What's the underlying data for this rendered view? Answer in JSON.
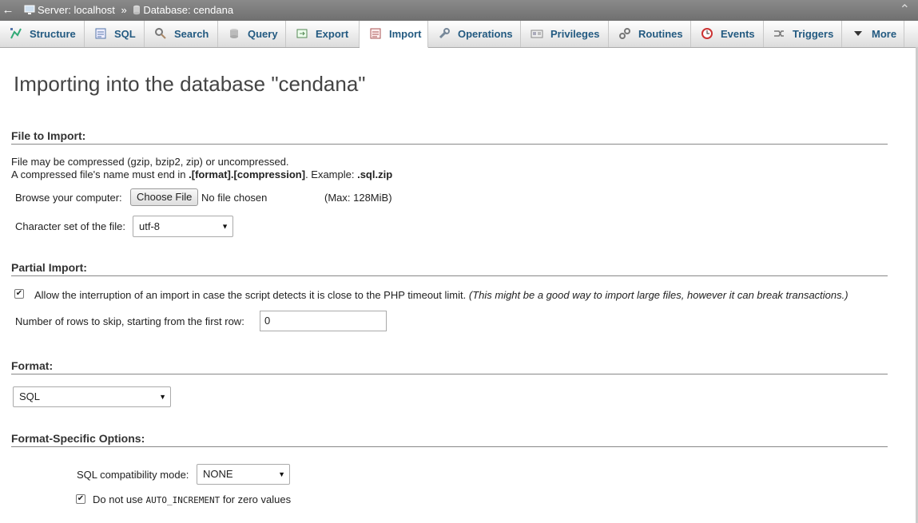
{
  "breadcrumb": {
    "server": "Server: localhost",
    "separator": "»",
    "database": "Database: cendana"
  },
  "tabs": [
    {
      "label": "Structure",
      "icon": "structure-icon"
    },
    {
      "label": "SQL",
      "icon": "sql-icon"
    },
    {
      "label": "Search",
      "icon": "search-icon"
    },
    {
      "label": "Query",
      "icon": "query-icon"
    },
    {
      "label": "Export",
      "icon": "export-icon"
    },
    {
      "label": "Import",
      "icon": "import-icon",
      "active": true
    },
    {
      "label": "Operations",
      "icon": "wrench-icon"
    },
    {
      "label": "Privileges",
      "icon": "privileges-icon"
    },
    {
      "label": "Routines",
      "icon": "routines-icon"
    },
    {
      "label": "Events",
      "icon": "clock-icon"
    },
    {
      "label": "Triggers",
      "icon": "triggers-icon"
    },
    {
      "label": "More",
      "icon": "triangle-down-icon"
    }
  ],
  "page_title": "Importing into the database \"cendana\"",
  "file_section": {
    "heading": "File to Import:",
    "line1": "File may be compressed (gzip, bzip2, zip) or uncompressed.",
    "line2_prefix": "A compressed file's name must end in ",
    "line2_bold1": ".[format].[compression]",
    "line2_mid": ". Example: ",
    "line2_bold2": ".sql.zip",
    "browse_label": "Browse your computer:",
    "choose_button": "Choose File",
    "no_file": "No file chosen",
    "max": "(Max: 128MiB)",
    "charset_label": "Character set of the file:",
    "charset_value": "utf-8"
  },
  "partial_section": {
    "heading": "Partial Import:",
    "allow_checked": true,
    "allow_text": "Allow the interruption of an import in case the script detects it is close to the PHP timeout limit.",
    "allow_note": "(This might be a good way to import large files, however it can break transactions.)",
    "skip_label": "Number of rows to skip, starting from the first row:",
    "skip_value": "0"
  },
  "format_section": {
    "heading": "Format:",
    "format_value": "SQL"
  },
  "options_section": {
    "heading": "Format-Specific Options:",
    "compat_label": "SQL compatibility mode:",
    "compat_value": "NONE",
    "auto_inc_checked": true,
    "auto_inc_pre": "Do not use ",
    "auto_inc_code": "AUTO_INCREMENT",
    "auto_inc_post": " for zero values"
  },
  "colors": {
    "tab_text": "#235a81",
    "topbar": "#7a7a7a"
  }
}
